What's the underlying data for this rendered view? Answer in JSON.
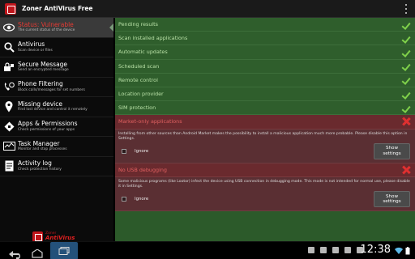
{
  "app": {
    "title": "Zoner AntiVirus Free"
  },
  "sidebar": {
    "items": [
      {
        "title": "Status: Vulnerable",
        "subtitle": "The current status of the device"
      },
      {
        "title": "Antivirus",
        "subtitle": "Scan device or files"
      },
      {
        "title": "Secure Message",
        "subtitle": "Send an encrypted message"
      },
      {
        "title": "Phone Filtering",
        "subtitle": "Block calls/messages for set numbers"
      },
      {
        "title": "Missing device",
        "subtitle": "Find lost device and control it remotely"
      },
      {
        "title": "Apps & Permissions",
        "subtitle": "Check permissions of your apps"
      },
      {
        "title": "Task Manager",
        "subtitle": "Monitor and stop processes"
      },
      {
        "title": "Activity log",
        "subtitle": "Check protection history"
      }
    ],
    "brand": {
      "line1": "Zoner",
      "line2": "AntiVirus"
    }
  },
  "checks": [
    "Pending results",
    "Scan installed applications",
    "Automatic updates",
    "Scheduled scan",
    "Remote control",
    "Location provider",
    "SIM protection"
  ],
  "alerts": [
    {
      "title": "Market-only applications",
      "description": "Installing from other sources than Android Market makes the possibility to install a malicious application much more probable. Please disable this option in Settings.",
      "ignore_label": "Ignore",
      "button_label": "Show\nsettings"
    },
    {
      "title": "No USB debugging",
      "description": "Some malicious programs (like Lootor) infect the device using USB connection in debugging mode. This mode is not intended for normal use, please disable it in Settings.",
      "ignore_label": "Ignore",
      "button_label": "Show\nsettings"
    }
  ],
  "system": {
    "clock": "12:38"
  },
  "colors": {
    "accent_red": "#c0151b",
    "ok_green": "#7fd04a",
    "status_red": "#e53b34"
  }
}
